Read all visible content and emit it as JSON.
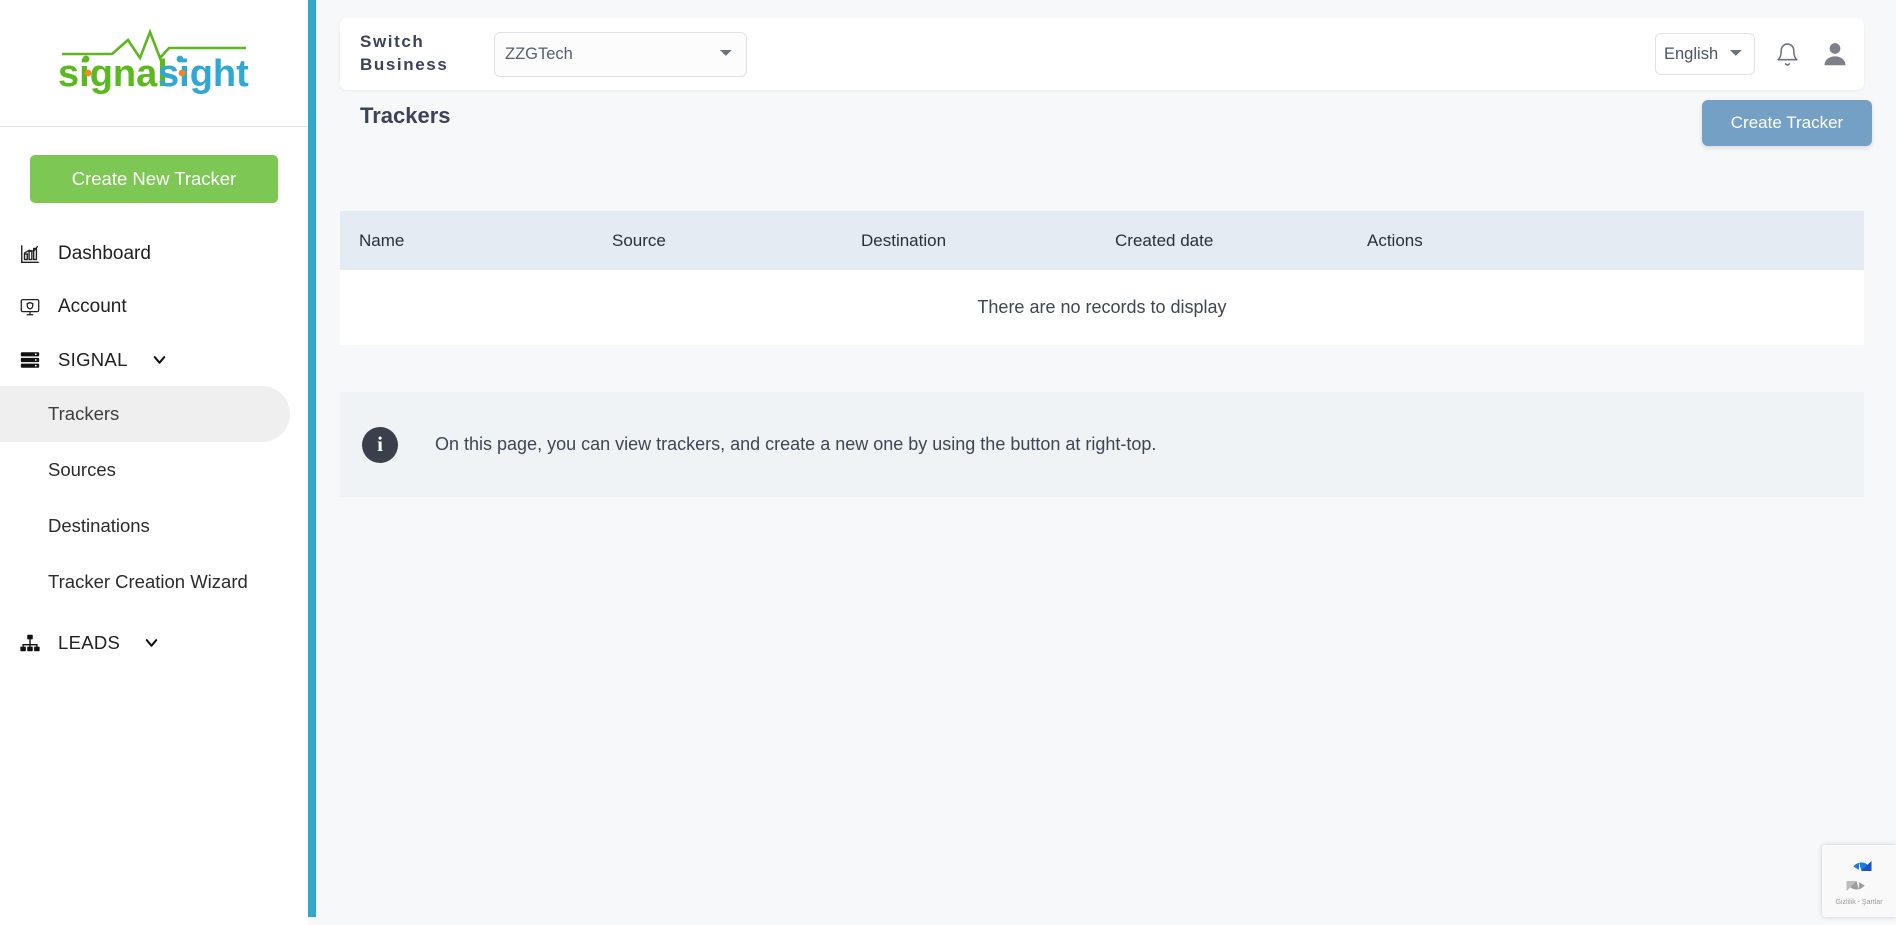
{
  "brand": {
    "logo_text_primary": "signal",
    "logo_text_secondary": "sight",
    "color_green": "#5cb81f",
    "color_blue": "#31a8d4",
    "color_orange": "#f08a1e"
  },
  "sidebar": {
    "create_new_tracker_label": "Create New Tracker",
    "items": [
      {
        "label": "Dashboard",
        "icon": "bar-chart-icon",
        "type": "link"
      },
      {
        "label": "Account",
        "icon": "monitor-shield-icon",
        "type": "link"
      },
      {
        "label": "SIGNAL",
        "icon": "server-stack-icon",
        "type": "group",
        "expanded": true
      },
      {
        "label": "Trackers",
        "type": "sub",
        "active": true
      },
      {
        "label": "Sources",
        "type": "sub",
        "active": false
      },
      {
        "label": "Destinations",
        "type": "sub",
        "active": false
      },
      {
        "label": "Tracker Creation Wizard",
        "type": "sub",
        "active": false
      },
      {
        "label": "LEADS",
        "icon": "sitemap-icon",
        "type": "group",
        "expanded": false
      }
    ]
  },
  "header": {
    "switch_business_label": "Switch Business",
    "business_selected": "ZZGTech",
    "business_options": [
      "ZZGTech"
    ],
    "language_selected": "English",
    "language_options": [
      "English"
    ],
    "notification_icon": "bell-icon",
    "avatar_icon": "user-avatar-icon"
  },
  "page": {
    "title": "Trackers",
    "create_tracker_label": "Create Tracker",
    "create_tracker_color": "#73a0c4"
  },
  "table": {
    "columns": [
      "Name",
      "Source",
      "Destination",
      "Created date",
      "Actions"
    ],
    "rows": [],
    "empty_message": "There are no records to display",
    "header_bg": "#e5ebf2"
  },
  "info_banner": {
    "icon": "info-circle-icon",
    "glyph": "i",
    "text": "On this page, you can view trackers, and create a new one by using the button at right-top."
  },
  "recaptcha": {
    "label": "Gizlilik - Şartlar",
    "icon": "recaptcha-icon"
  },
  "accent_color": "#2fa8cc"
}
